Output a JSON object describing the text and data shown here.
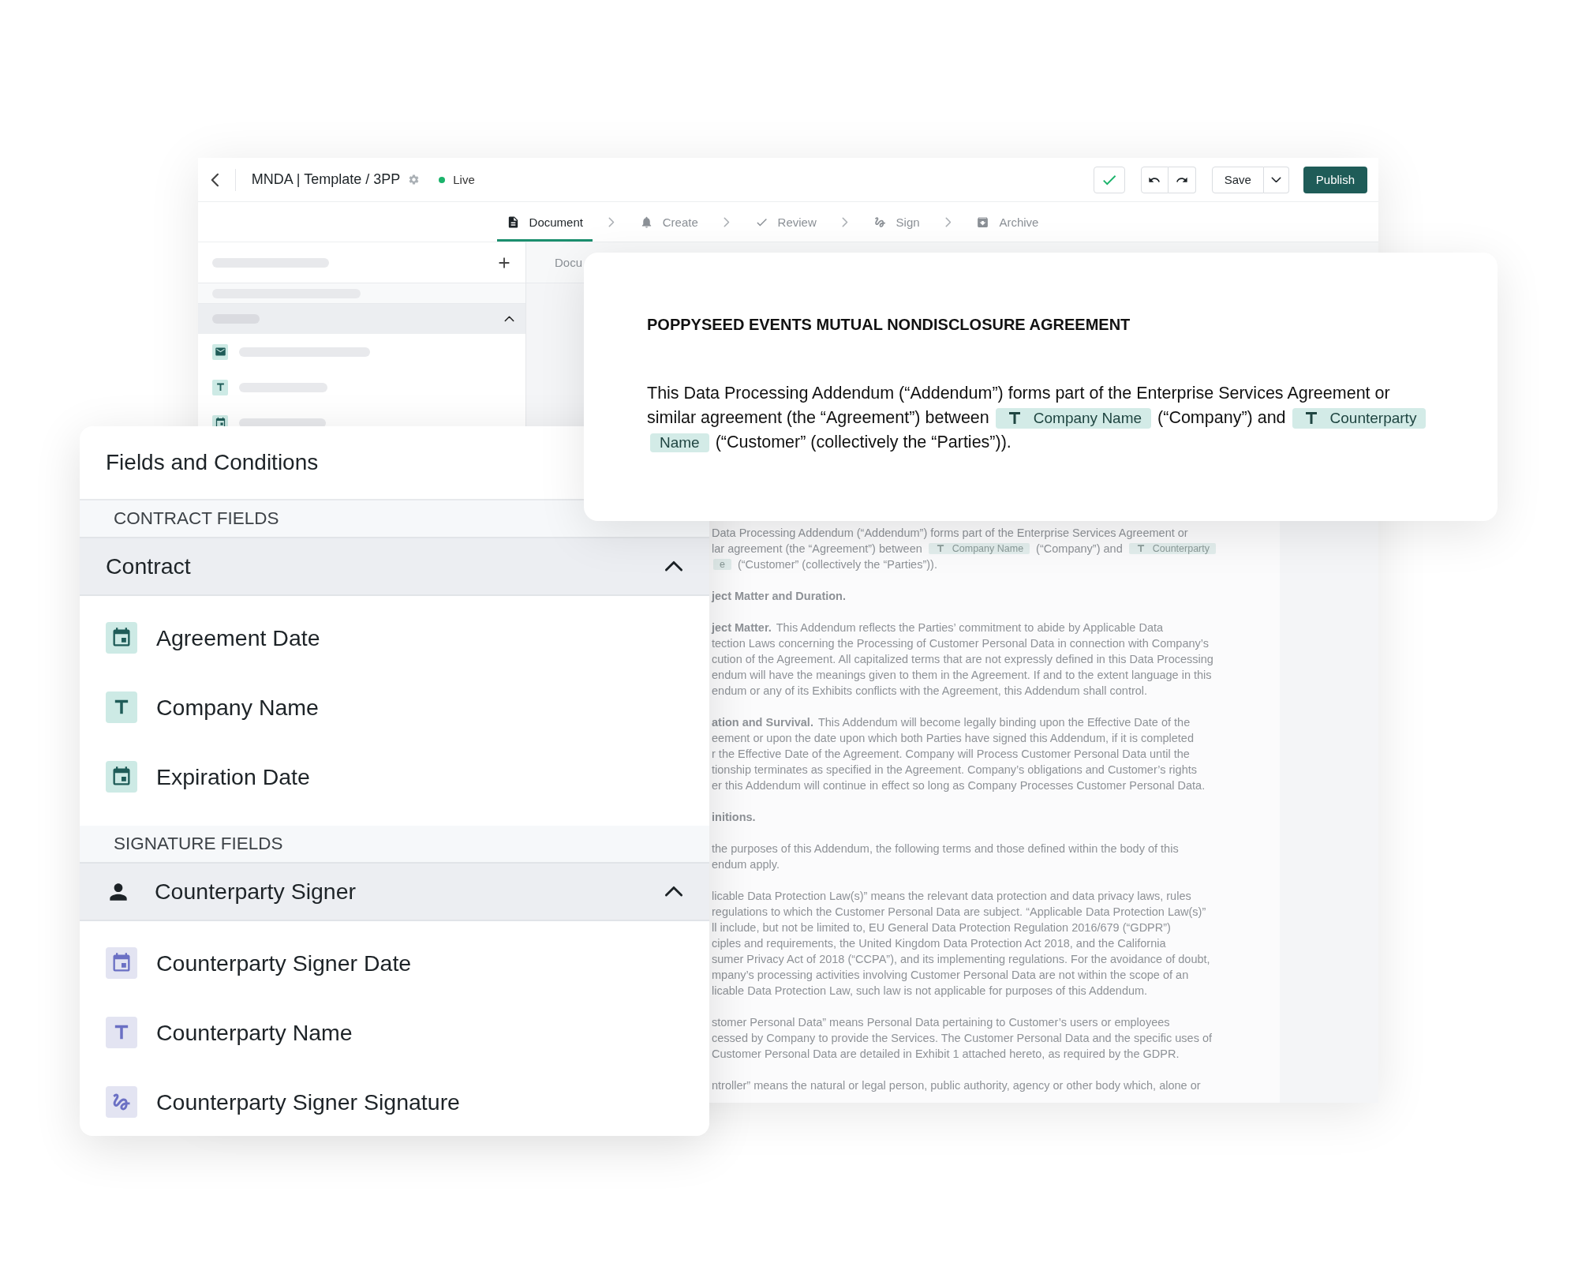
{
  "header": {
    "title": "MNDA | Template / 3PP",
    "status": "Live",
    "save": "Save",
    "publish": "Publish"
  },
  "steps": [
    {
      "label": "Document",
      "kind": "document",
      "selected": true
    },
    {
      "label": "Create",
      "kind": "create",
      "selected": false
    },
    {
      "label": "Review",
      "kind": "review",
      "selected": false
    },
    {
      "label": "Sign",
      "kind": "sign",
      "selected": false
    },
    {
      "label": "Archive",
      "kind": "archive",
      "selected": false
    }
  ],
  "sidebar": {
    "group_expanded": true,
    "items": [
      {
        "kind": "email"
      },
      {
        "kind": "text"
      },
      {
        "kind": "date"
      }
    ]
  },
  "document": {
    "tab_label": "Docu",
    "paragraphs": [
      [
        [
          {
            "kind": "text",
            "text": "Data Processing Addendum (“Addendum”) forms part of the Enterprise Services Agreement or"
          }
        ],
        [
          {
            "kind": "text",
            "text": "lar agreement (the “Agreement”) between"
          },
          {
            "kind": "chip",
            "text": "Company Name"
          },
          {
            "kind": "text",
            "text": "(“Company”) and"
          },
          {
            "kind": "chip",
            "text": "Counterparty"
          }
        ],
        [
          {
            "kind": "chip_end",
            "text": "e"
          },
          {
            "kind": "text",
            "text": "(“Customer” (collectively the “Parties”))."
          }
        ]
      ],
      [
        [
          {
            "kind": "bold",
            "text": "ject Matter and Duration."
          }
        ]
      ],
      [
        [
          {
            "kind": "bold",
            "text": "ject Matter."
          },
          {
            "kind": "text",
            "text": " This Addendum reflects the Parties’ commitment to abide by Applicable Data"
          }
        ],
        [
          {
            "kind": "text",
            "text": "tection Laws concerning the Processing of Customer Personal Data in connection with Company’s"
          }
        ],
        [
          {
            "kind": "text",
            "text": "cution of the Agreement. All capitalized terms that are not expressly defined in this Data Processing"
          }
        ],
        [
          {
            "kind": "text",
            "text": "endum will have the meanings given to them in the Agreement. If and to the extent language in this"
          }
        ],
        [
          {
            "kind": "text",
            "text": "endum or any of its Exhibits conflicts with the Agreement, this Addendum shall control."
          }
        ]
      ],
      [
        [
          {
            "kind": "bold",
            "text": "ation and Survival."
          },
          {
            "kind": "text",
            "text": " This Addendum will become legally binding upon the Effective Date of the"
          }
        ],
        [
          {
            "kind": "text",
            "text": "eement or upon the date upon which both Parties have signed this Addendum, if it is completed"
          }
        ],
        [
          {
            "kind": "text",
            "text": "r the Effective Date of the Agreement. Company will Process Customer Personal Data until the"
          }
        ],
        [
          {
            "kind": "text",
            "text": "tionship terminates as specified in the Agreement. Company’s obligations and Customer’s rights"
          }
        ],
        [
          {
            "kind": "text",
            "text": "er this Addendum will continue in effect so long as Company Processes Customer Personal Data."
          }
        ]
      ],
      [
        [
          {
            "kind": "bold",
            "text": "initions."
          }
        ]
      ],
      [
        [
          {
            "kind": "text",
            "text": "the purposes of this Addendum, the following terms and those defined within the body of this"
          }
        ],
        [
          {
            "kind": "text",
            "text": "endum apply."
          }
        ]
      ],
      [
        [
          {
            "kind": "text",
            "text": "licable Data Protection Law(s)” means the relevant data protection and data privacy laws, rules"
          }
        ],
        [
          {
            "kind": "text",
            "text": "regulations to which the Customer Personal Data are subject. “Applicable Data Protection Law(s)”"
          }
        ],
        [
          {
            "kind": "text",
            "text": "ll include, but not be limited to, EU General Data Protection Regulation 2016/679 (“GDPR”)"
          }
        ],
        [
          {
            "kind": "text",
            "text": "ciples and requirements, the United Kingdom Data Protection Act 2018, and the California"
          }
        ],
        [
          {
            "kind": "text",
            "text": "sumer Privacy Act of 2018 (“CCPA”), and its implementing regulations.  For the avoidance of doubt,"
          }
        ],
        [
          {
            "kind": "text",
            "text": "mpany’s processing activities involving Customer Personal Data are not within the scope of an"
          }
        ],
        [
          {
            "kind": "text",
            "text": "licable Data Protection Law, such law is not applicable for purposes of this Addendum."
          }
        ]
      ],
      [
        [
          {
            "kind": "text",
            "text": "stomer Personal Data” means Personal Data pertaining to Customer’s users or employees"
          }
        ],
        [
          {
            "kind": "text",
            "text": "cessed by Company to provide the Services. The Customer Personal Data and the specific uses of"
          }
        ],
        [
          {
            "kind": "text",
            "text": "Customer Personal Data are detailed in Exhibit 1 attached hereto, as required by the GDPR."
          }
        ]
      ],
      [
        [
          {
            "kind": "text",
            "text": "ntroller” means the natural or legal person, public authority, agency or other body which, alone or"
          }
        ]
      ]
    ]
  },
  "card": {
    "title": "POPPYSEED EVENTS MUTUAL NONDISCLOSURE AGREEMENT",
    "lines": [
      [
        {
          "kind": "text",
          "text": "This Data Processing Addendum (“Addendum”) forms part of the Enterprise Services Agreement or"
        }
      ],
      [
        {
          "kind": "text",
          "text": "similar agreement (the “Agreement”) between"
        },
        {
          "kind": "chip",
          "text": "Company Name"
        },
        {
          "kind": "text",
          "text": "(“Company”) and"
        },
        {
          "kind": "chip",
          "text": "Counterparty"
        }
      ],
      [
        {
          "kind": "chip_end",
          "text": "Name"
        },
        {
          "kind": "text",
          "text": "(“Customer” (collectively the “Parties”))."
        }
      ]
    ]
  },
  "fields_panel": {
    "title": "Fields and Conditions",
    "sections": [
      {
        "heading": "CONTRACT FIELDS",
        "group": "Contract",
        "kind": "contract",
        "expanded": true,
        "fields": [
          {
            "label": "Agreement Date",
            "kind": "date"
          },
          {
            "label": "Company Name",
            "kind": "text"
          },
          {
            "label": "Expiration Date",
            "kind": "date"
          }
        ]
      },
      {
        "heading": "SIGNATURE FIELDS",
        "group": "Counterparty Signer",
        "kind": "signer",
        "expanded": true,
        "fields": [
          {
            "label": "Counterparty Signer Date",
            "kind": "date"
          },
          {
            "label": "Counterparty Name",
            "kind": "text"
          },
          {
            "label": "Counterparty Signer Signature",
            "kind": "signature"
          }
        ]
      }
    ]
  }
}
